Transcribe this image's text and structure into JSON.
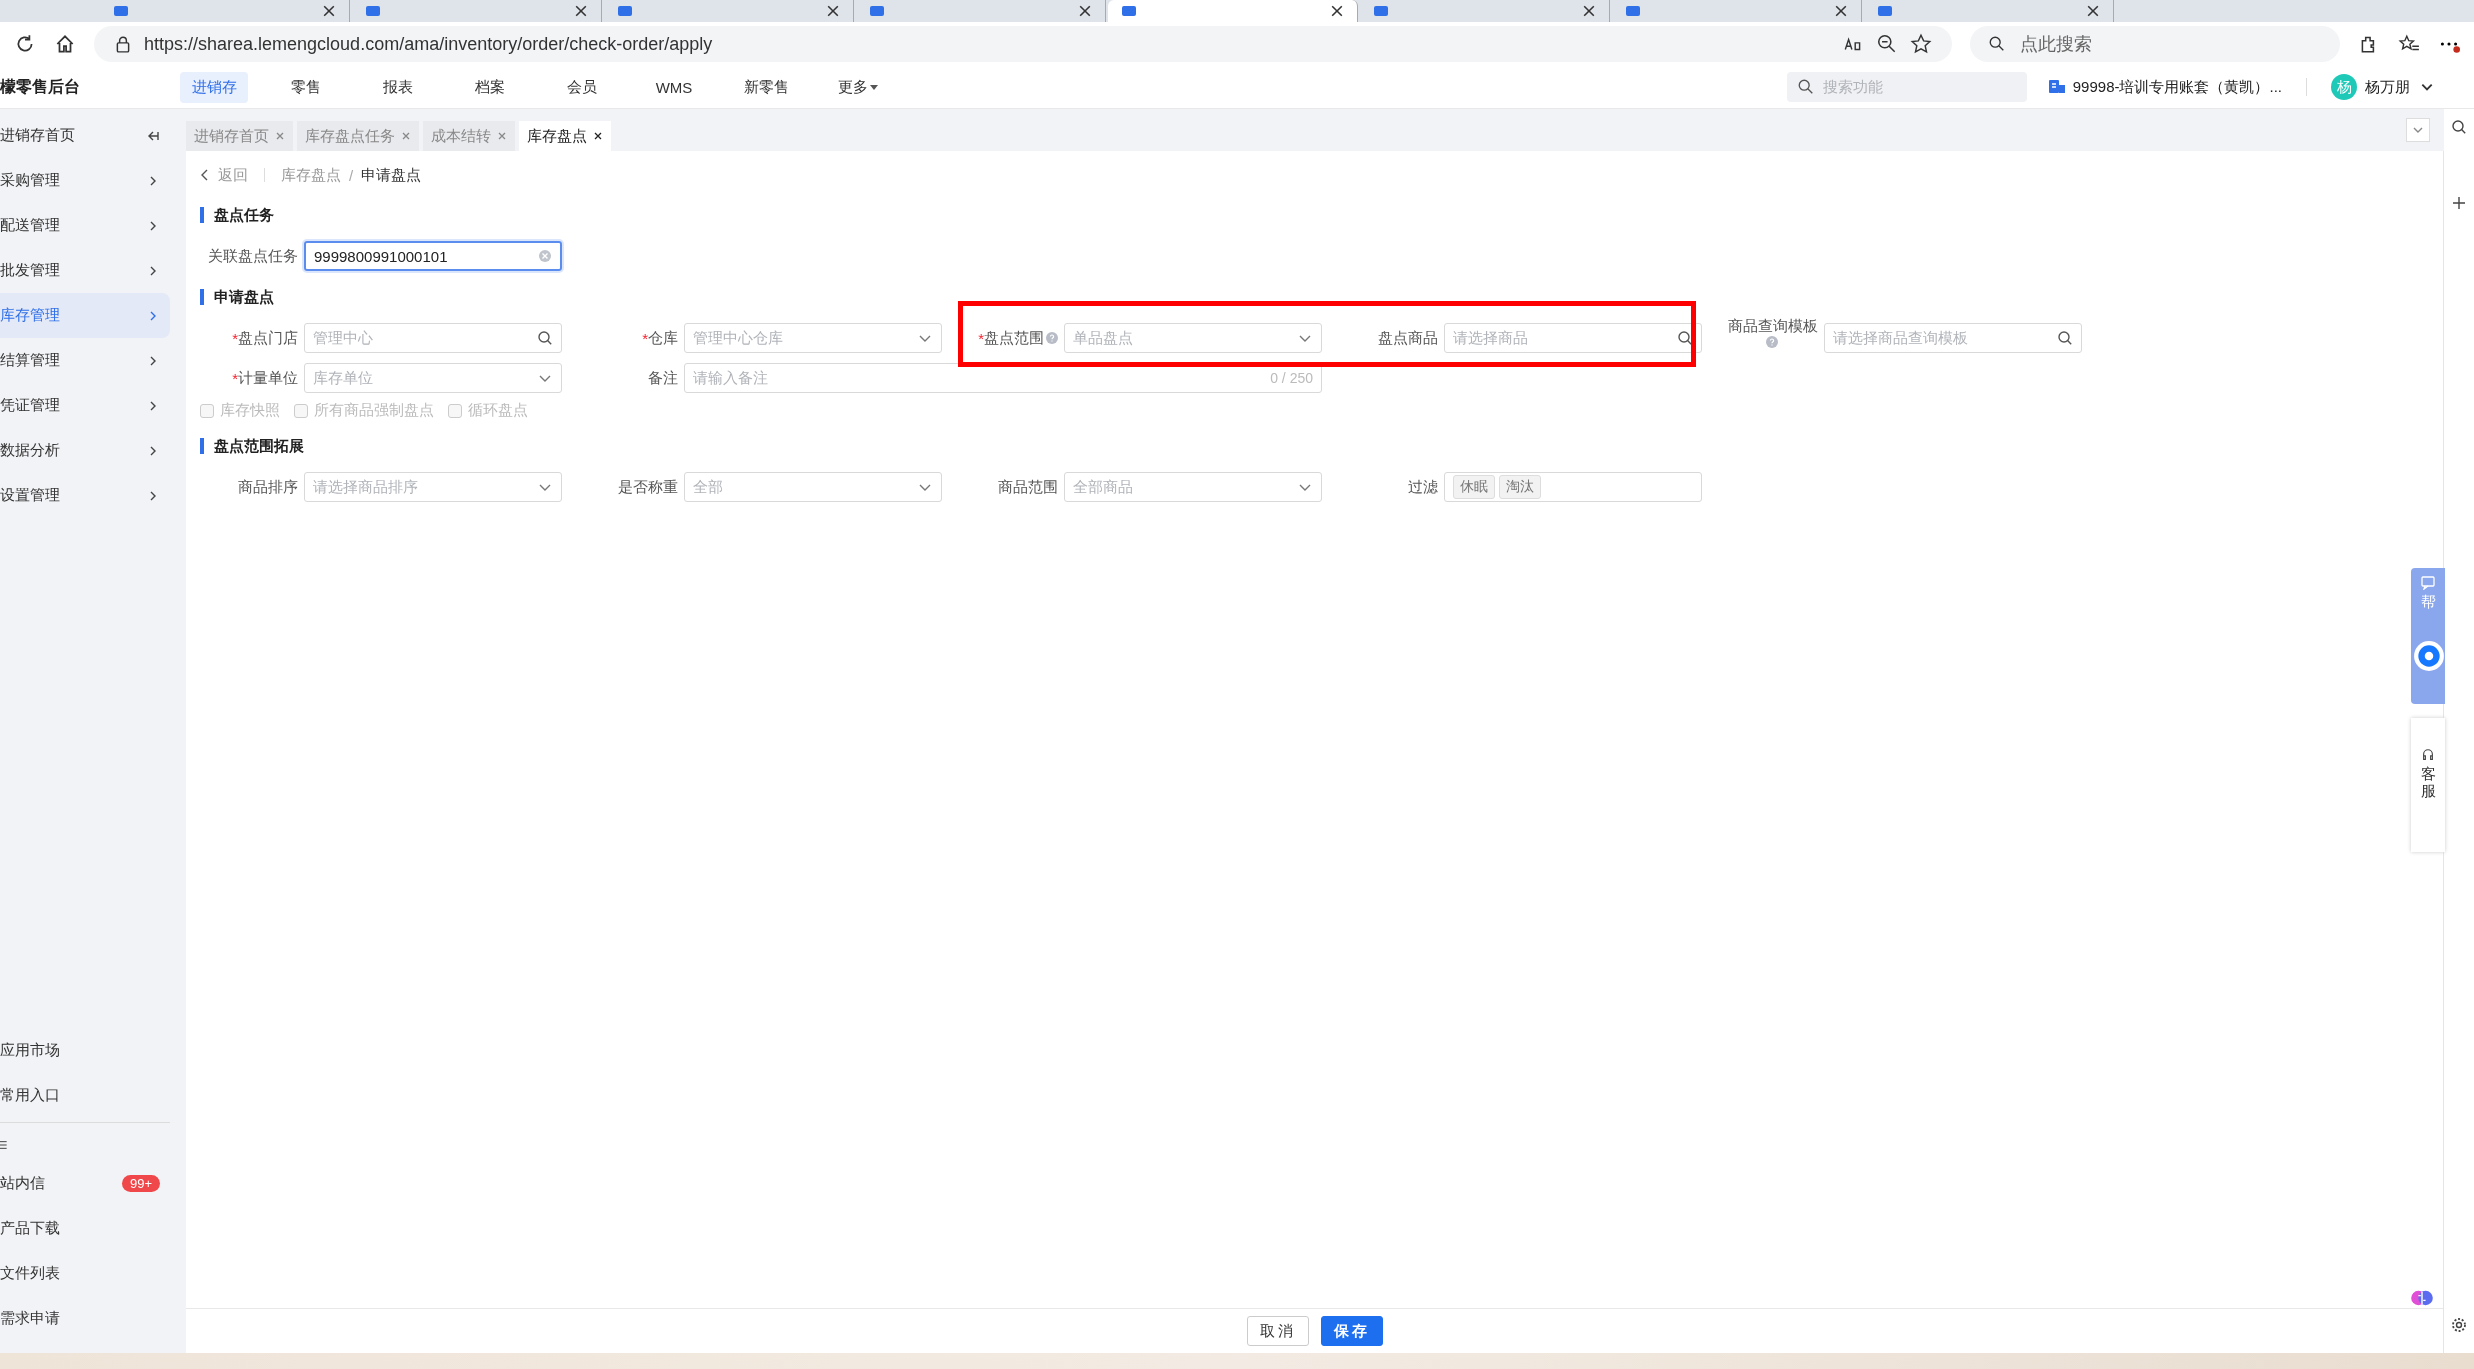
{
  "browser": {
    "tabs": [
      {
        "selected": false
      },
      {
        "selected": false
      },
      {
        "selected": false
      },
      {
        "selected": false
      },
      {
        "selected": true
      },
      {
        "selected": false
      },
      {
        "selected": false
      },
      {
        "selected": false
      }
    ],
    "url": "https://sharea.lemengcloud.com/ama/inventory/order/check-order/apply",
    "search_placeholder": "点此搜索"
  },
  "header": {
    "brand": "檬零售后台",
    "nav": [
      {
        "label": "进销存",
        "selected": true
      },
      {
        "label": "零售",
        "selected": false
      },
      {
        "label": "报表",
        "selected": false
      },
      {
        "label": "档案",
        "selected": false
      },
      {
        "label": "会员",
        "selected": false
      },
      {
        "label": "WMS",
        "selected": false
      },
      {
        "label": "新零售",
        "selected": false
      },
      {
        "label": "更多",
        "selected": false,
        "kind": "dropdown"
      }
    ],
    "search_placeholder": "搜索功能",
    "account": "99998-培训专用账套（黄凯）...",
    "avatar": "杨",
    "user": "杨万朋"
  },
  "sidebar": {
    "items": [
      {
        "label": "进销存首页",
        "kind": "home",
        "selected": false
      },
      {
        "label": "采购管理",
        "kind": "menu",
        "selected": false
      },
      {
        "label": "配送管理",
        "kind": "menu",
        "selected": false
      },
      {
        "label": "批发管理",
        "kind": "menu",
        "selected": false
      },
      {
        "label": "库存管理",
        "kind": "menu",
        "selected": true
      },
      {
        "label": "结算管理",
        "kind": "menu",
        "selected": false
      },
      {
        "label": "凭证管理",
        "kind": "menu",
        "selected": false
      },
      {
        "label": "数据分析",
        "kind": "menu",
        "selected": false
      },
      {
        "label": "设置管理",
        "kind": "menu",
        "selected": false
      }
    ],
    "bottom_items": [
      {
        "label": "应用市场"
      },
      {
        "label": "常用入口"
      }
    ],
    "extra_items": [
      {
        "label": "站内信",
        "badge": "99+"
      },
      {
        "label": "产品下载"
      },
      {
        "label": "文件列表"
      },
      {
        "label": "需求申请"
      }
    ]
  },
  "page_tabs": [
    {
      "label": "进销存首页",
      "selected": false
    },
    {
      "label": "库存盘点任务",
      "selected": false
    },
    {
      "label": "成本结转",
      "selected": false
    },
    {
      "label": "库存盘点",
      "selected": true
    }
  ],
  "breadcrumb": {
    "back": "返回",
    "path": [
      {
        "label": "库存盘点"
      },
      {
        "label": "申请盘点",
        "separator": "/"
      }
    ]
  },
  "task_section": {
    "title": "盘点任务",
    "field": {
      "label": "关联盘点任务",
      "value": "9999800991000101"
    }
  },
  "apply_section": {
    "title": "申请盘点",
    "rows": [
      [
        {
          "label": "盘点门店",
          "required_mark": "*",
          "kind": "search",
          "placeholder": "管理中心"
        },
        {
          "label": "仓库",
          "required_mark": "*",
          "kind": "select",
          "placeholder": "管理中心仓库"
        },
        {
          "label": "盘点范围",
          "required_mark": "*",
          "kind": "select",
          "placeholder": "单品盘点",
          "help": true
        },
        {
          "label": "盘点商品",
          "kind": "search",
          "placeholder": "请选择商品"
        },
        {
          "label": "商品查询模板",
          "kind": "search",
          "placeholder": "请选择商品查询模板",
          "help": true,
          "label_wrap": true
        }
      ],
      [
        {
          "label": "计量单位",
          "required_mark": "*",
          "kind": "select",
          "placeholder": "库存单位"
        },
        {
          "label": "备注",
          "kind": "textarea",
          "placeholder": "请输入备注",
          "counter": "0 / 250"
        }
      ]
    ],
    "checkboxes": [
      {
        "label": "库存快照",
        "checked": false,
        "disabled": true
      },
      {
        "label": "所有商品强制盘点",
        "checked": false,
        "disabled": true
      },
      {
        "label": "循环盘点",
        "checked": false,
        "disabled": true
      }
    ]
  },
  "extend_section": {
    "title": "盘点范围拓展",
    "fields": [
      {
        "label": "商品排序",
        "kind": "select",
        "placeholder": "请选择商品排序"
      },
      {
        "label": "是否称重",
        "kind": "select",
        "placeholder": "全部"
      },
      {
        "label": "商品范围",
        "kind": "select",
        "placeholder": "全部商品"
      },
      {
        "label": "过滤",
        "kind": "tags",
        "tags": [
          "休眠",
          "淘汰"
        ]
      }
    ]
  },
  "footer": {
    "buttons": [
      {
        "label": "取消",
        "kind": "default"
      },
      {
        "label": "保存",
        "kind": "primary"
      }
    ]
  },
  "float": {
    "help": "帮",
    "service": "客服"
  }
}
